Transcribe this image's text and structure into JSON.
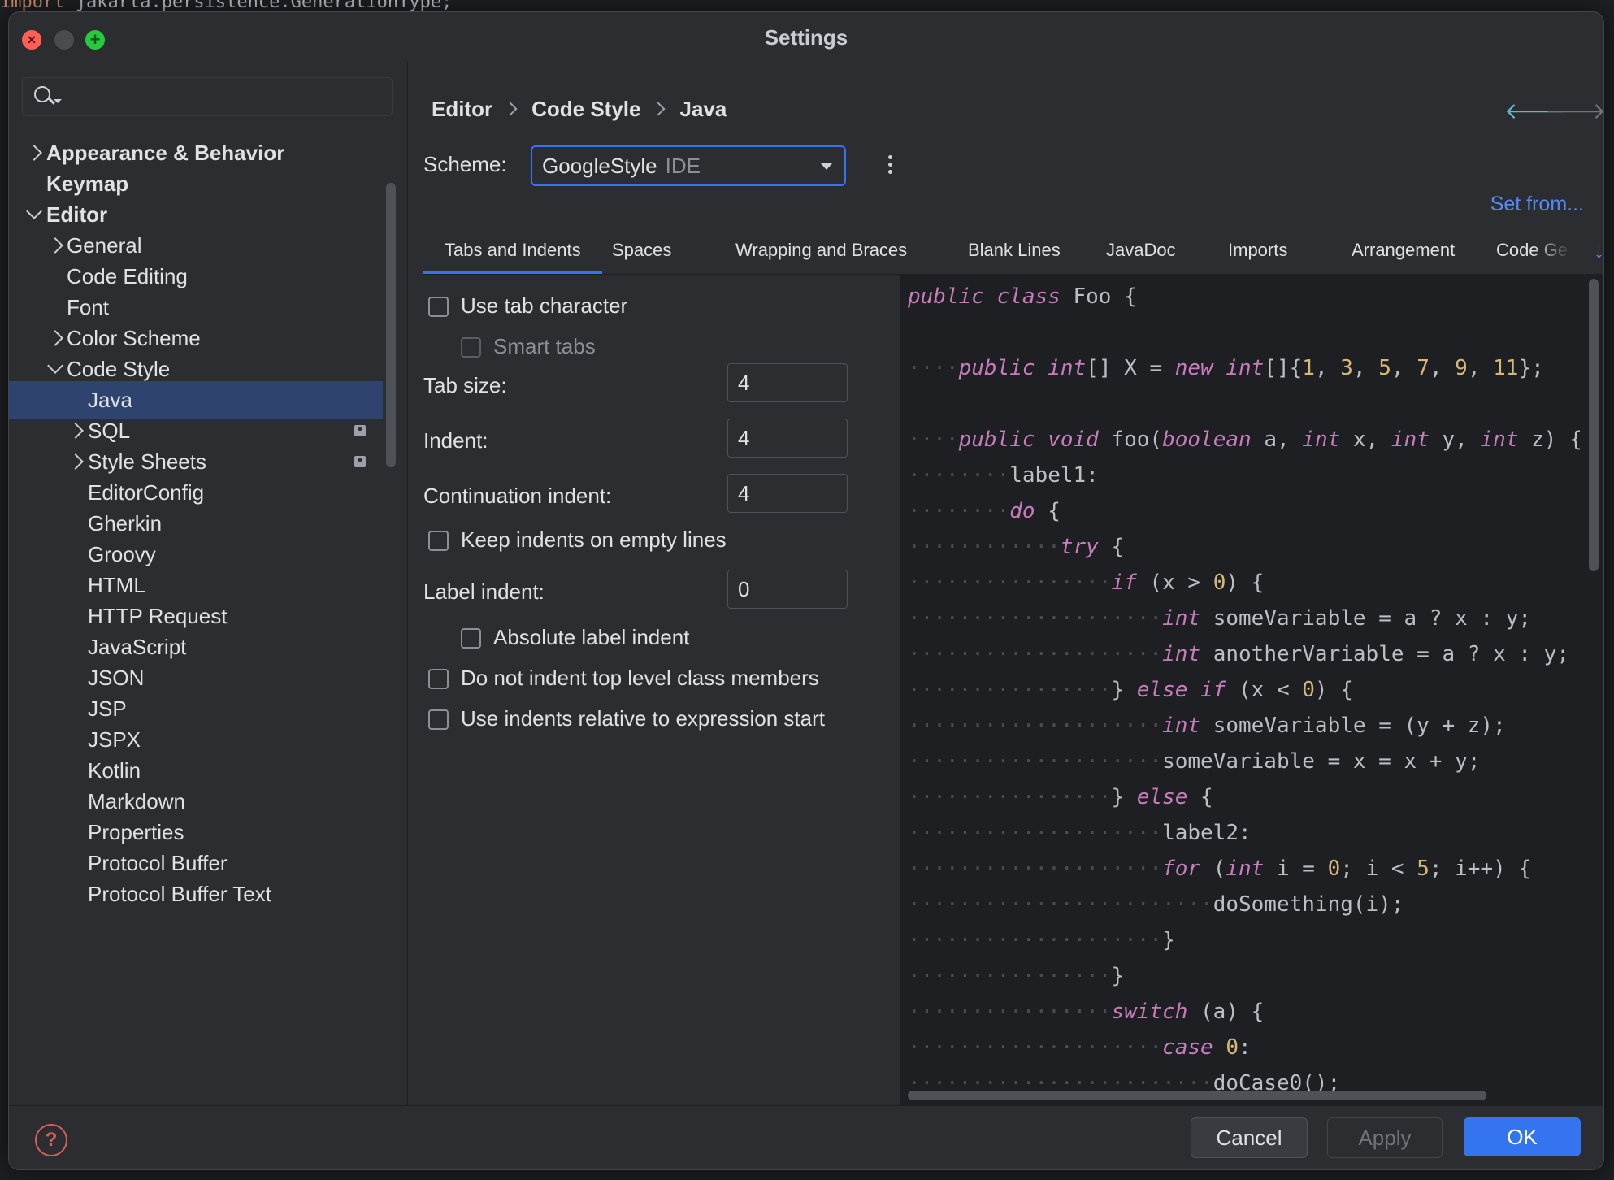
{
  "dialog": {
    "title": "Settings"
  },
  "background": {
    "top_line_keyword": "import",
    "top_line_text": " jakarta.persistence.GenerationType;"
  },
  "sidebar": {
    "search_placeholder": "",
    "items": [
      {
        "label": "Appearance & Behavior"
      },
      {
        "label": "Keymap"
      },
      {
        "label": "Editor"
      },
      {
        "label": "General"
      },
      {
        "label": "Code Editing"
      },
      {
        "label": "Font"
      },
      {
        "label": "Color Scheme"
      },
      {
        "label": "Code Style"
      },
      {
        "label": "Java"
      },
      {
        "label": "SQL"
      },
      {
        "label": "Style Sheets"
      },
      {
        "label": "EditorConfig"
      },
      {
        "label": "Gherkin"
      },
      {
        "label": "Groovy"
      },
      {
        "label": "HTML"
      },
      {
        "label": "HTTP Request"
      },
      {
        "label": "JavaScript"
      },
      {
        "label": "JSON"
      },
      {
        "label": "JSP"
      },
      {
        "label": "JSPX"
      },
      {
        "label": "Kotlin"
      },
      {
        "label": "Markdown"
      },
      {
        "label": "Properties"
      },
      {
        "label": "Protocol Buffer"
      },
      {
        "label": "Protocol Buffer Text"
      }
    ]
  },
  "breadcrumb": {
    "items": [
      "Editor",
      "Code Style",
      "Java"
    ]
  },
  "scheme": {
    "label": "Scheme:",
    "value": "GoogleStyle",
    "scope": "IDE",
    "set_from": "Set from..."
  },
  "tabs": [
    "Tabs and Indents",
    "Spaces",
    "Wrapping and Braces",
    "Blank Lines",
    "JavaDoc",
    "Imports",
    "Arrangement",
    "Code Ge"
  ],
  "options": {
    "use_tab_character": "Use tab character",
    "smart_tabs": "Smart tabs",
    "tab_size_label": "Tab size:",
    "tab_size": "4",
    "indent_label": "Indent:",
    "indent": "4",
    "continuation_indent_label": "Continuation indent:",
    "continuation_indent": "4",
    "keep_indents": "Keep indents on empty lines",
    "label_indent_label": "Label indent:",
    "label_indent": "0",
    "absolute_label_indent": "Absolute label indent",
    "no_indent_top_level": "Do not indent top level class members",
    "relative_to_expression": "Use indents relative to expression start"
  },
  "footer": {
    "help": "?",
    "cancel": "Cancel",
    "apply": "Apply",
    "ok": "OK"
  },
  "colors": {
    "accent": "#3574f0",
    "selection": "#2e436e",
    "keyword": "#c77dbb",
    "link": "#548af7"
  }
}
